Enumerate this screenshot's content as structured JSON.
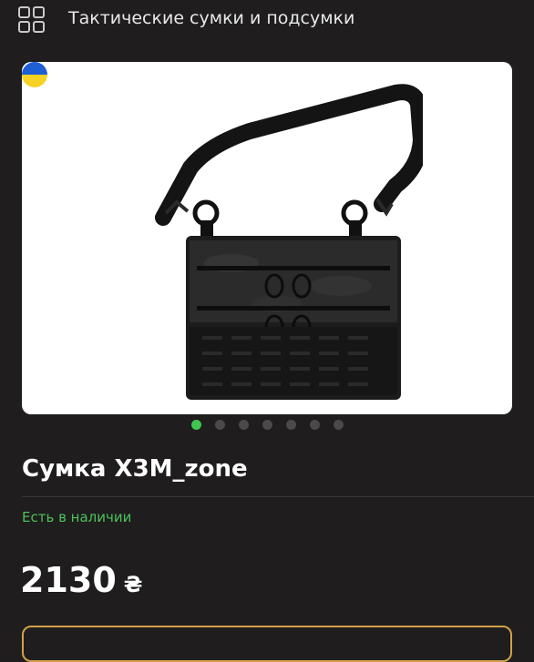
{
  "header": {
    "category_title": "Тактические сумки и подсумки"
  },
  "gallery": {
    "image_subject": "black multicam tactical shoulder bag",
    "flag": "Ukraine",
    "slide_count": 7,
    "active_slide": 1
  },
  "product": {
    "name": "Сумка X3M_zone",
    "availability": "Есть в наличии",
    "price": "2130",
    "currency": "₴"
  },
  "colors": {
    "background": "#1f1d1e",
    "accent_green": "#41c552",
    "button_border": "#d1a24a"
  }
}
